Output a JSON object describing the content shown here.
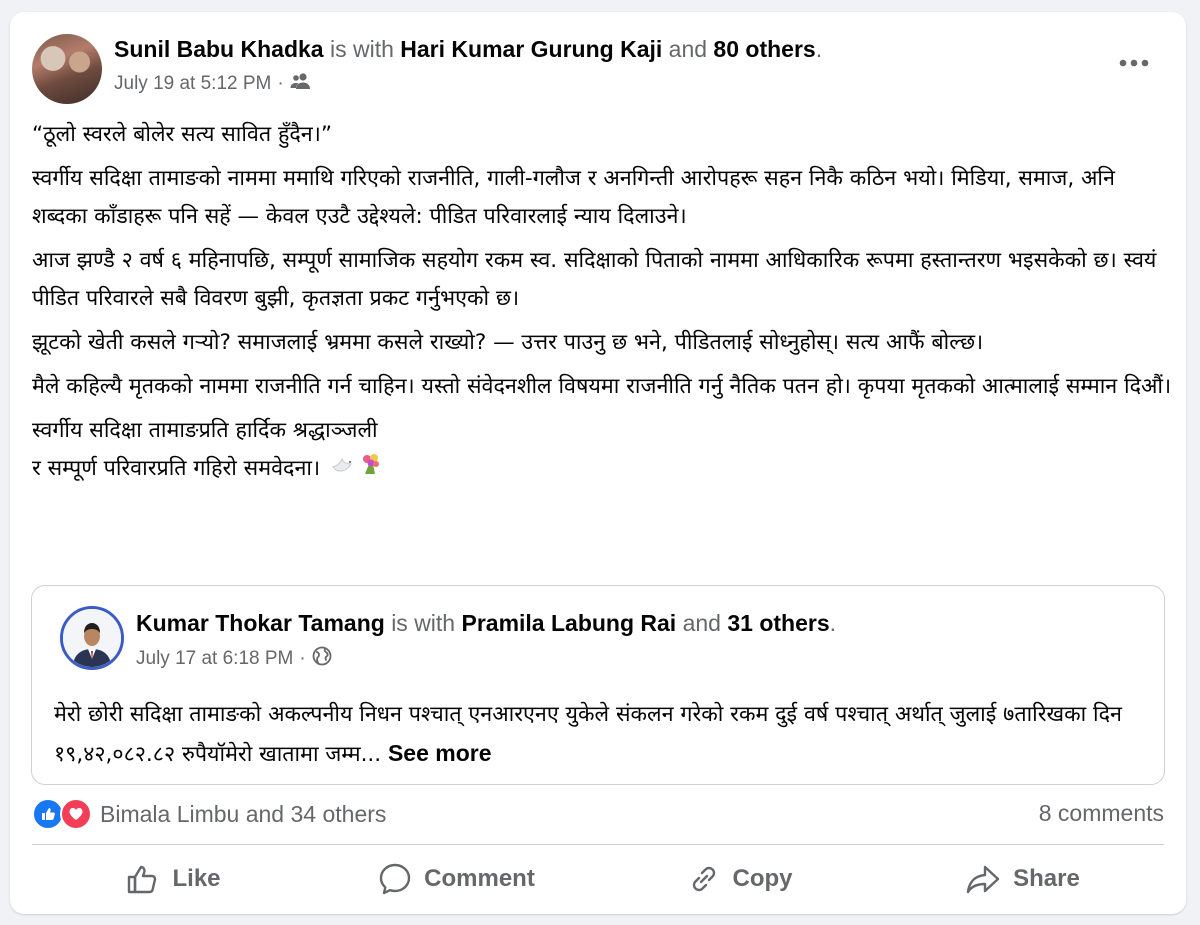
{
  "post": {
    "author": "Sunil Babu Khadka",
    "with_text": "is with",
    "tagged_person": "Hari Kumar Gurung Kaji",
    "and_text": "and",
    "others": "80 others",
    "period": ".",
    "timestamp": "July 19 at 5:12 PM",
    "separator": "·",
    "audience_icon": "friends-icon",
    "paragraphs": [
      "“ठूलो स्वरले बोलेर सत्य सावित हुँदैन।”",
      "स्वर्गीय सदिक्षा तामाङको नाममा ममाथि गरिएको राजनीति, गाली-गलौज र अनगिन्ती आरोपहरू सहन निकै कठिन भयो। मिडिया, समाज, अनि शब्दका काँडाहरू पनि सहें — केवल एउटै उद्देश्यले: पीडित परिवारलाई न्याय दिलाउने।",
      "आज झण्डै २ वर्ष ६ महिनापछि, सम्पूर्ण सामाजिक सहयोग रकम स्व. सदिक्षाको पिताको नाममा आधिकारिक रूपमा हस्तान्तरण भइसकेको छ। स्वयं पीडित परिवारले सबै विवरण बुझी, कृतज्ञता प्रकट गर्नुभएको छ।",
      "झूटको खेती कसले गर्‍यो? समाजलाई भ्रममा कसले राख्यो? — उत्तर पाउनु छ भने, पीडितलाई सोध्नुहोस्। सत्य आफैं बोल्छ।",
      "मैले कहिल्यै मृतकको नाममा राजनीति गर्न चाहिन। यस्तो संवेदनशील विषयमा राजनीति गर्नु नैतिक पतन हो। कृपया मृतकको आत्मालाई सम्मान दिऔं।"
    ],
    "closing_line1": "स्वर्गीय सदिक्षा तामाङप्रति हार्दिक श्रद्धाञ्जली",
    "closing_line2": "र सम्पूर्ण परिवारप्रति गहिरो समवेदना।"
  },
  "shared": {
    "author": "Kumar Thokar Tamang",
    "with_text": "is with",
    "tagged_person": "Pramila Labung Rai",
    "and_text": "and",
    "others": "31 others",
    "period": ".",
    "timestamp": "July 17 at 6:18 PM",
    "separator": "·",
    "audience_icon": "globe-icon",
    "text": "मेरो छोरी सदिक्षा तामाङको अकल्पनीय निधन पश्चात् एनआरएनए युकेले संकलन गरेको रकम दुई वर्ष पश्चात् अर्थात् जुलाई ७तारिखका दिन १९,४२,०८२.८२ रुपैयॉमेरो खातामा जम्म...",
    "see_more": "See more"
  },
  "reactions": {
    "summary": "Bimala Limbu and 34 others",
    "comments": "8 comments",
    "icons": [
      "like-icon",
      "love-icon"
    ]
  },
  "actions": {
    "like": "Like",
    "comment": "Comment",
    "copy": "Copy",
    "share": "Share"
  },
  "colors": {
    "like_blue": "#1877f2",
    "love_red": "#f33e58",
    "secondary_text": "#65676b"
  }
}
